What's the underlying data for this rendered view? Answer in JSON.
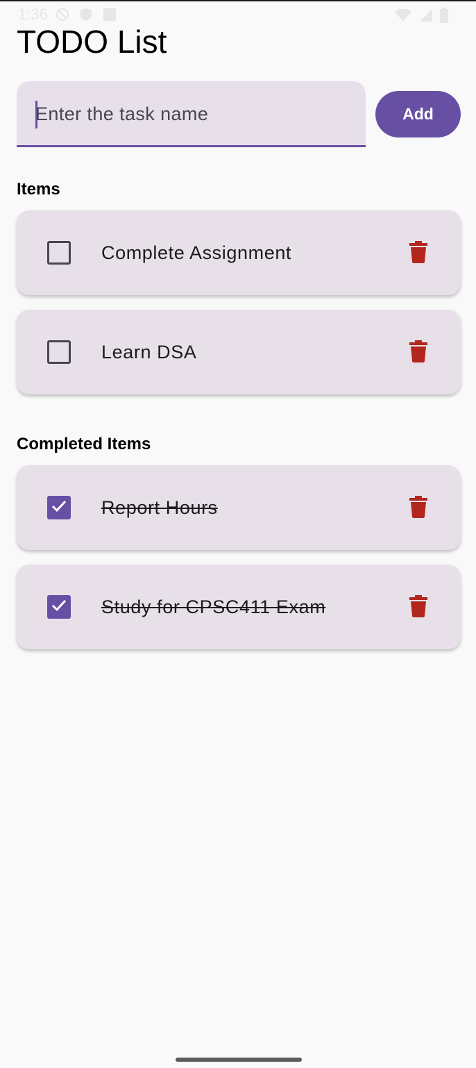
{
  "status_bar": {
    "time": "1:36",
    "left_icons": [
      "do-not-disturb-icon",
      "shield-icon",
      "font-icon"
    ],
    "right_icons": [
      "wifi-icon",
      "signal-icon",
      "battery-icon"
    ]
  },
  "app": {
    "title": "TODO List"
  },
  "task_input": {
    "value": "",
    "placeholder": "Enter the task name"
  },
  "add_button": {
    "label": "Add"
  },
  "sections": {
    "items_heading": "Items",
    "completed_heading": "Completed Items"
  },
  "items": [
    {
      "label": "Complete Assignment",
      "checked": false
    },
    {
      "label": "Learn DSA",
      "checked": false
    }
  ],
  "completed_items": [
    {
      "label": "Report Hours",
      "checked": true
    },
    {
      "label": "Study for CPSC411 Exam",
      "checked": true
    }
  ],
  "colors": {
    "accent": "#6750a4",
    "card": "#e7e0e8",
    "delete": "#b3261e",
    "background": "#f9f9f9"
  }
}
